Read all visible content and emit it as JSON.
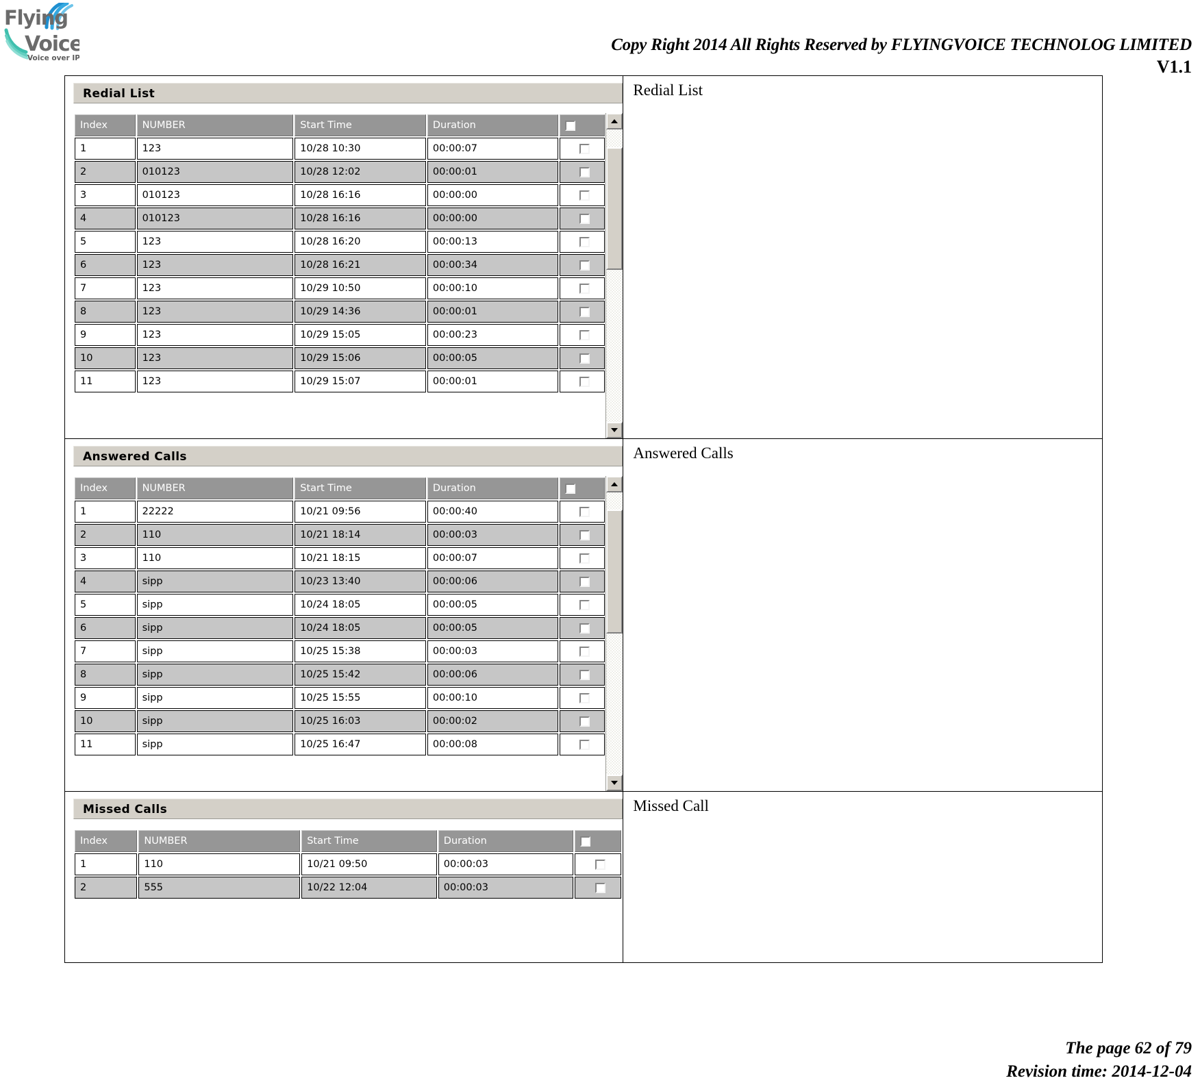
{
  "header": {
    "logo_name": "flyingvoice-logo",
    "logo_line1": "Flying",
    "logo_line2": "Voice",
    "logo_tagline": "Voice over IP",
    "copyright": "Copy Right 2014 All Rights Reserved by FLYINGVOICE TECHNOLOG LIMITED",
    "version": "V1.1"
  },
  "footer": {
    "page": "The page 62 of 79",
    "revision": "Revision time: 2014-12-04"
  },
  "columns": {
    "index": "Index",
    "number": "NUMBER",
    "start_time": "Start Time",
    "duration": "Duration",
    "select": ""
  },
  "sections": [
    {
      "panel_title": "Redial List",
      "description": "Redial List",
      "scroll": {
        "thumb_top_pct": 6,
        "thumb_height_pct": 42
      },
      "rows": [
        {
          "index": "1",
          "number": "123",
          "start": "10/28 10:30",
          "duration": "00:00:07"
        },
        {
          "index": "2",
          "number": "010123",
          "start": "10/28 12:02",
          "duration": "00:00:01"
        },
        {
          "index": "3",
          "number": "010123",
          "start": "10/28 16:16",
          "duration": "00:00:00"
        },
        {
          "index": "4",
          "number": "010123",
          "start": "10/28 16:16",
          "duration": "00:00:00"
        },
        {
          "index": "5",
          "number": "123",
          "start": "10/28 16:20",
          "duration": "00:00:13"
        },
        {
          "index": "6",
          "number": "123",
          "start": "10/28 16:21",
          "duration": "00:00:34"
        },
        {
          "index": "7",
          "number": "123",
          "start": "10/29 10:50",
          "duration": "00:00:10"
        },
        {
          "index": "8",
          "number": "123",
          "start": "10/29 14:36",
          "duration": "00:00:01"
        },
        {
          "index": "9",
          "number": "123",
          "start": "10/29 15:05",
          "duration": "00:00:23"
        },
        {
          "index": "10",
          "number": "123",
          "start": "10/29 15:06",
          "duration": "00:00:05"
        },
        {
          "index": "11",
          "number": "123",
          "start": "10/29 15:07",
          "duration": "00:00:01"
        }
      ]
    },
    {
      "panel_title": "Answered Calls",
      "description": "Answered Calls",
      "scroll": {
        "thumb_top_pct": 6,
        "thumb_height_pct": 44
      },
      "rows": [
        {
          "index": "1",
          "number": "22222",
          "start": "10/21 09:56",
          "duration": "00:00:40"
        },
        {
          "index": "2",
          "number": "110",
          "start": "10/21 18:14",
          "duration": "00:00:03"
        },
        {
          "index": "3",
          "number": "110",
          "start": "10/21 18:15",
          "duration": "00:00:07"
        },
        {
          "index": "4",
          "number": "sipp",
          "start": "10/23 13:40",
          "duration": "00:00:06"
        },
        {
          "index": "5",
          "number": "sipp",
          "start": "10/24 18:05",
          "duration": "00:00:05"
        },
        {
          "index": "6",
          "number": "sipp",
          "start": "10/24 18:05",
          "duration": "00:00:05"
        },
        {
          "index": "7",
          "number": "sipp",
          "start": "10/25 15:38",
          "duration": "00:00:03"
        },
        {
          "index": "8",
          "number": "sipp",
          "start": "10/25 15:42",
          "duration": "00:00:06"
        },
        {
          "index": "9",
          "number": "sipp",
          "start": "10/25 15:55",
          "duration": "00:00:10"
        },
        {
          "index": "10",
          "number": "sipp",
          "start": "10/25 16:03",
          "duration": "00:00:02"
        },
        {
          "index": "11",
          "number": "sipp",
          "start": "10/25 16:47",
          "duration": "00:00:08"
        }
      ]
    },
    {
      "panel_title": "Missed Calls",
      "description": "Missed Call",
      "scroll": null,
      "rows": [
        {
          "index": "1",
          "number": "110",
          "start": "10/21 09:50",
          "duration": "00:00:03"
        },
        {
          "index": "2",
          "number": "555",
          "start": "10/22 12:04",
          "duration": "00:00:03"
        }
      ]
    }
  ],
  "colors": {
    "panel_title_bg": "#d4d0c8",
    "table_header_bg": "#969696",
    "row_alt_bg": "#c6c6c6",
    "row_bg": "#ffffff",
    "logo_gray": "#6b6b6b",
    "logo_blue": "#29a3dc",
    "logo_teal": "#4ec8b4"
  }
}
